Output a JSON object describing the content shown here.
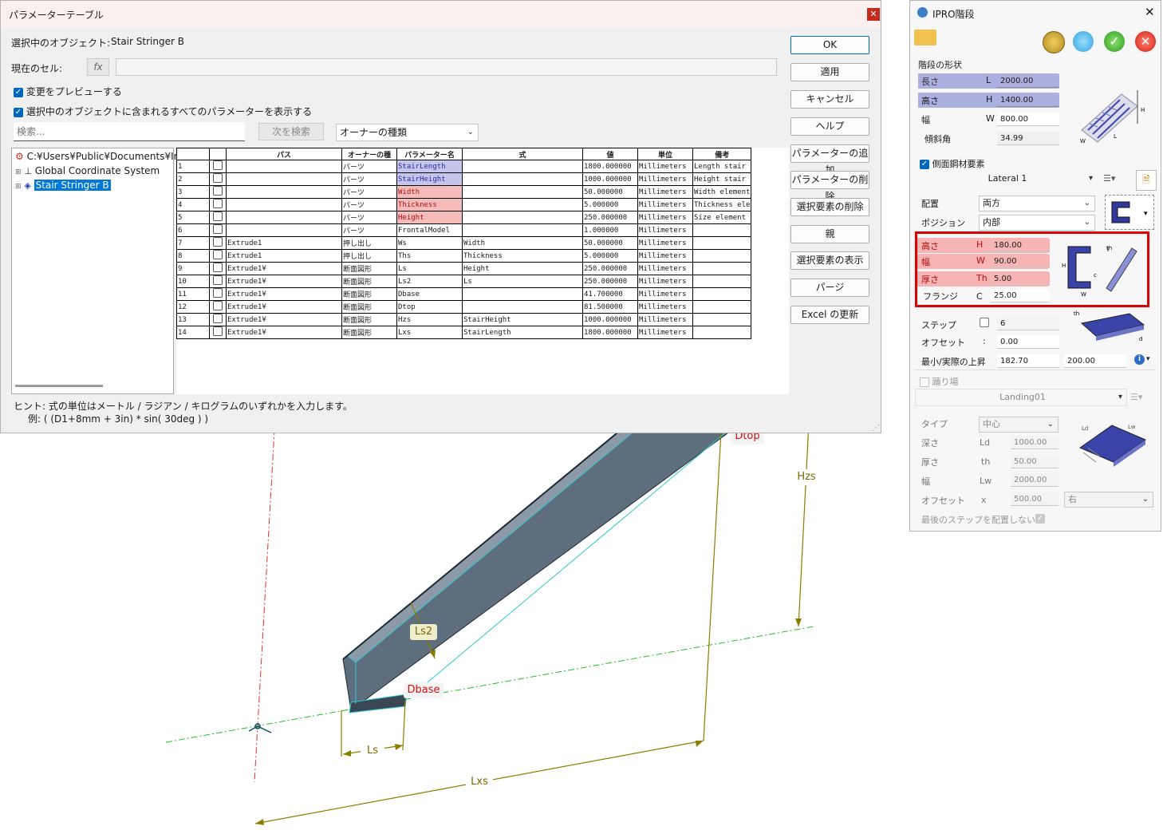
{
  "param_dialog": {
    "title": "パラメーターテーブル",
    "selected_object_label": "選択中のオブジェクト:",
    "selected_object_value": "Stair Stringer B",
    "current_cell_label": "現在のセル:",
    "fx_label": "fx",
    "preview_checkbox": "変更をプレビューする",
    "show_all_checkbox": "選択中のオブジェクトに含まれるすべてのパラメーターを表示する",
    "search_placeholder": "検索...",
    "find_next_button": "次を検索",
    "owner_type_select": "オーナーの種類",
    "tree": {
      "root": "C:¥Users¥Public¥Documents¥Iron",
      "child1": "Global Coordinate System",
      "child2": "Stair Stringer B"
    },
    "columns": [
      "",
      "",
      "パス",
      "オーナーの種",
      "パラメーター名",
      "式",
      "値",
      "単位",
      "備考"
    ],
    "rows": [
      {
        "n": "1",
        "path": "",
        "owner": "パーツ",
        "name": "StairLength",
        "expr": "",
        "value": "1800.000000",
        "unit": "Millimeters",
        "note": "Length stair",
        "hl": "blue"
      },
      {
        "n": "2",
        "path": "",
        "owner": "パーツ",
        "name": "StairHeight",
        "expr": "",
        "value": "1000.000000",
        "unit": "Millimeters",
        "note": "Height stair",
        "hl": "blue"
      },
      {
        "n": "3",
        "path": "",
        "owner": "パーツ",
        "name": "Width",
        "expr": "",
        "value": "50.000000",
        "unit": "Millimeters",
        "note": "Width element",
        "hl": "red"
      },
      {
        "n": "4",
        "path": "",
        "owner": "パーツ",
        "name": "Thickness",
        "expr": "",
        "value": "5.000000",
        "unit": "Millimeters",
        "note": "Thickness ele",
        "hl": "red"
      },
      {
        "n": "5",
        "path": "",
        "owner": "パーツ",
        "name": "Height",
        "expr": "",
        "value": "250.000000",
        "unit": "Millimeters",
        "note": "Size element",
        "hl": "red"
      },
      {
        "n": "6",
        "path": "",
        "owner": "パーツ",
        "name": "FrontalModel",
        "expr": "",
        "value": "1.000000",
        "unit": "Millimeters",
        "note": "",
        "hl": ""
      },
      {
        "n": "7",
        "path": "Extrude1",
        "owner": "押し出し",
        "name": "Ws",
        "expr": "Width",
        "value": "50.000000",
        "unit": "Millimeters",
        "note": "",
        "hl": ""
      },
      {
        "n": "8",
        "path": "Extrude1",
        "owner": "押し出し",
        "name": "Ths",
        "expr": "Thickness",
        "value": "5.000000",
        "unit": "Millimeters",
        "note": "",
        "hl": ""
      },
      {
        "n": "9",
        "path": "Extrude1¥",
        "owner": "断面図形",
        "name": "Ls",
        "expr": "Height",
        "value": "250.000000",
        "unit": "Millimeters",
        "note": "",
        "hl": ""
      },
      {
        "n": "10",
        "path": "Extrude1¥",
        "owner": "断面図形",
        "name": "Ls2",
        "expr": "Ls",
        "value": "250.000000",
        "unit": "Millimeters",
        "note": "",
        "hl": ""
      },
      {
        "n": "11",
        "path": "Extrude1¥",
        "owner": "断面図形",
        "name": "Dbase",
        "expr": "",
        "value": "41.700000",
        "unit": "Millimeters",
        "note": "",
        "hl": ""
      },
      {
        "n": "12",
        "path": "Extrude1¥",
        "owner": "断面図形",
        "name": "Dtop",
        "expr": "",
        "value": "81.500000",
        "unit": "Millimeters",
        "note": "",
        "hl": ""
      },
      {
        "n": "13",
        "path": "Extrude1¥",
        "owner": "断面図形",
        "name": "Hzs",
        "expr": "StairHeight",
        "value": "1000.000000",
        "unit": "Millimeters",
        "note": "",
        "hl": ""
      },
      {
        "n": "14",
        "path": "Extrude1¥",
        "owner": "断面図形",
        "name": "Lxs",
        "expr": "StairLength",
        "value": "1800.000000",
        "unit": "Millimeters",
        "note": "",
        "hl": ""
      }
    ],
    "buttons": [
      "OK",
      "適用",
      "キャンセル",
      "ヘルプ",
      "パラメーターの追加",
      "パラメーターの削除",
      "選択要素の削除",
      "親",
      "選択要素の表示",
      "パージ",
      "Excel の更新"
    ],
    "hint_line1": "ヒント: 式の単位はメートル / ラジアン / キログラムのいずれかを入力します。",
    "hint_line2": "例: ( (D1+8mm + 3in) * sin( 30deg ) )"
  },
  "viewport": {
    "labels": {
      "ls2": "Ls2",
      "dbase": "Dbase",
      "dtop": "Dtop",
      "hzs": "Hzs",
      "ls": "Ls",
      "lxs": "Lxs"
    }
  },
  "ipro_panel": {
    "title": "IPRO階段",
    "stair_shape_section": "階段の形状",
    "length": {
      "label": "長さ",
      "sym": "L",
      "value": "2000.00"
    },
    "height": {
      "label": "高さ",
      "sym": "H",
      "value": "1400.00"
    },
    "width": {
      "label": "幅",
      "sym": "W",
      "value": "800.00"
    },
    "incline": {
      "label": "傾斜角",
      "value": "34.99"
    },
    "side_steel_checkbox": "側面鋼材要素",
    "lateral_select": "Lateral 1",
    "placement": {
      "label": "配置",
      "value": "両方"
    },
    "position": {
      "label": "ポジション",
      "value": "内部"
    },
    "profile": {
      "height": {
        "label": "高さ",
        "sym": "H",
        "value": "180.00"
      },
      "width": {
        "label": "幅",
        "sym": "W",
        "value": "90.00"
      },
      "thickness": {
        "label": "厚さ",
        "sym": "Th",
        "value": "5.00"
      },
      "flange": {
        "label": "フランジ",
        "sym": "C",
        "value": "25.00"
      }
    },
    "step": {
      "label": "ステップ",
      "value": "6"
    },
    "offset": {
      "label": "オフセット",
      "sym": ":",
      "value": "0.00"
    },
    "rise": {
      "label": "最小/実際の上昇",
      "min": "182.70",
      "actual": "200.00"
    },
    "landing_checkbox": "踊り場",
    "landing_select": "Landing01",
    "type": {
      "label": "タイプ",
      "value": "中心"
    },
    "depth": {
      "label": "深さ",
      "sym": "Ld",
      "value": "1000.00"
    },
    "l_thickness": {
      "label": "厚さ",
      "sym": "th",
      "value": "50.00"
    },
    "l_width": {
      "label": "幅",
      "sym": "Lw",
      "value": "2000.00"
    },
    "l_offset": {
      "label": "オフセット",
      "sym": "x",
      "value": "500.00",
      "side": "右"
    },
    "last_step_label": "最後のステップを配置しない"
  }
}
